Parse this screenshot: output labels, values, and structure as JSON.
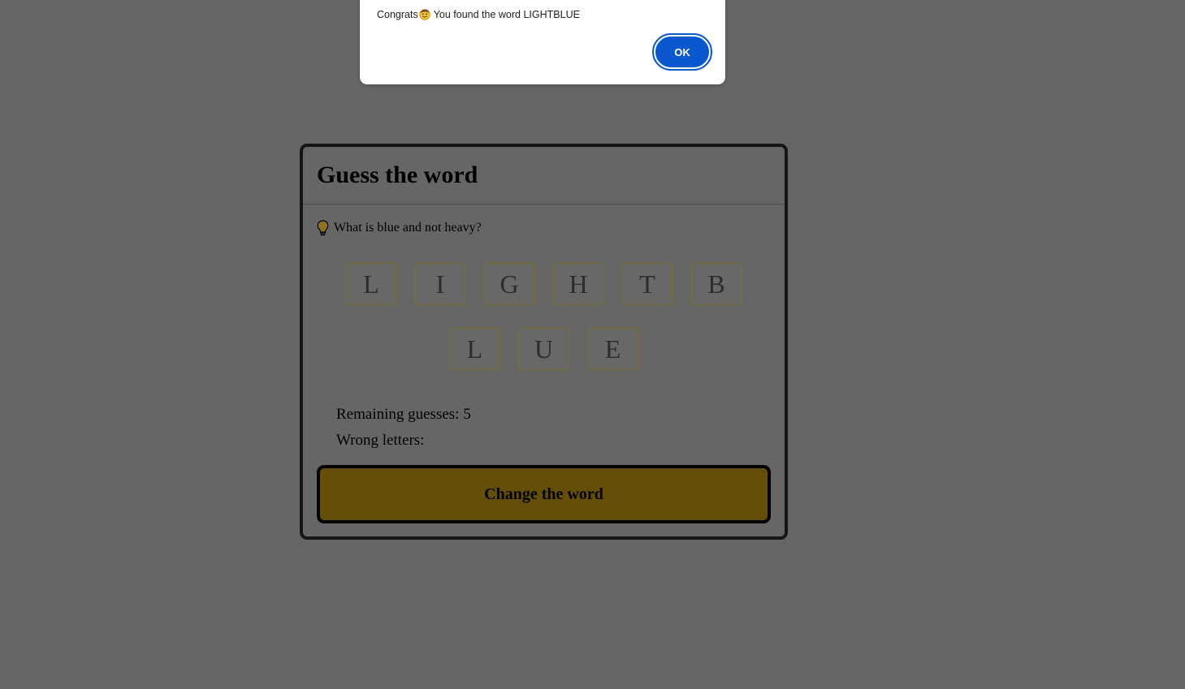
{
  "dialog": {
    "message_prefix": "Congrats",
    "message_suffix": " You found the word LIGHTBLUE",
    "smiley_icon": "smiling-face-icon",
    "ok_label": "OK",
    "ok_color": "#0b57d0"
  },
  "game": {
    "title": "Guess the word",
    "hint_icon": "lightbulb-icon",
    "hint": "What is blue and not heavy?",
    "letters_row1": [
      "L",
      "I",
      "G",
      "H",
      "T",
      "B"
    ],
    "letters_row2": [
      "L",
      "U",
      "E"
    ],
    "remaining_label": "Remaining guesses: 5",
    "wrong_label": "Wrong letters:",
    "change_button_label": "Change the word",
    "accent_color": "#654f08"
  }
}
